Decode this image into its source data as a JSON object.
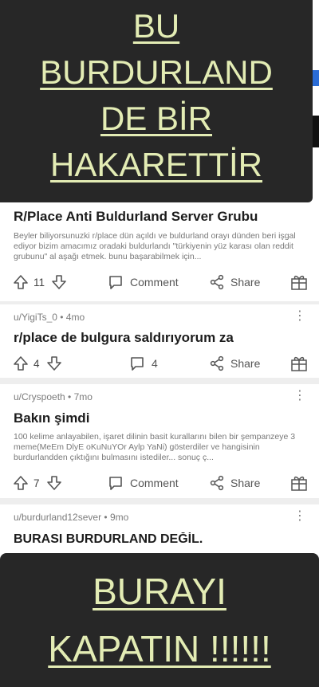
{
  "overlay_top": {
    "lines": [
      "BU",
      "BURDURLAND",
      "DE BİR",
      "HAKARETTİR"
    ],
    "bg_color": "#272727",
    "text_color": "#e3ecb4"
  },
  "overlay_bottom": {
    "lines": [
      "BURAYI",
      "KAPATIN !!!!!!"
    ]
  },
  "posts": [
    {
      "title": "R/Place Anti Buldurland Server Grubu",
      "body": "Beyler biliyorsunuzki r/place dün açıldı ve buldurland orayı dünden beri işgal ediyor bizim amacımız oradaki buldurlandı \"türkiyenin yüz karası olan reddit grubunu\" al aşağı etmek. bunu başarabilmek için...",
      "votes": "11",
      "comments_label": "Comment",
      "share_label": "Share"
    },
    {
      "meta": "u/YigiTs_0 • 4mo",
      "title": "r/place de bulgura saldırıyorum za",
      "votes": "4",
      "comments_label": "4",
      "share_label": "Share"
    },
    {
      "meta": "u/Cryspoeth • 7mo",
      "title": "Bakın şimdi",
      "body": "100 kelime anlayabilen, işaret dilinin basit kurallarını bilen bir şempanzeye 3 meme(MeEm DlyE oKuNuYOr Aylp YaNi) gösterdiler ve hangisinin burdurlandden çıktığını bulmasını istediler... sonuç ç...",
      "votes": "7",
      "comments_label": "Comment",
      "share_label": "Share"
    },
    {
      "meta": "u/burdurland12sever • 9mo",
      "title": "BURASI BURDURLAND DEĞİL."
    }
  ]
}
